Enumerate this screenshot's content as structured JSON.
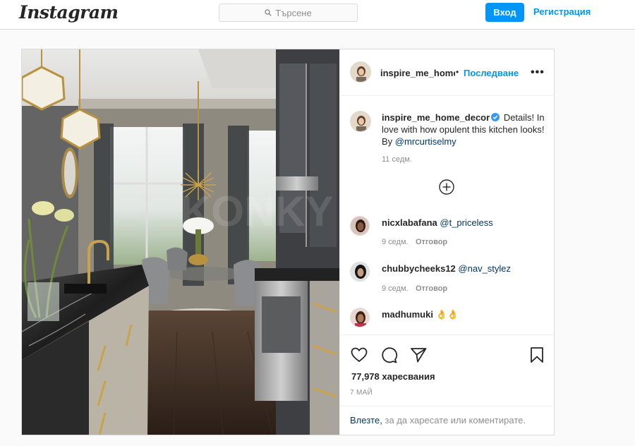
{
  "nav": {
    "logo": "Instagram",
    "search_placeholder": "Търсене",
    "login_label": "Вход",
    "register_label": "Регистрация"
  },
  "post": {
    "author": "inspire_me_home_decor",
    "author_header": "inspire_me_home",
    "dot": "•",
    "follow_label": "Последване",
    "more_label": "•••",
    "caption_text": "Details! In love with how opulent this kitchen looks! By",
    "caption_mention": "@mrcurtiselmy",
    "caption_time": "11 седм.",
    "likes": "77,978 харесвания",
    "date": "7 МАЙ",
    "login_link": "Влезте,",
    "login_rest": " за да харесате или коментирате."
  },
  "comments": [
    {
      "user": "nicxlabafana",
      "mention": "@t_priceless",
      "text": "",
      "time": "9 седм.",
      "reply": "Отговор"
    },
    {
      "user": "chubbycheeks12",
      "mention": "@nav_stylez",
      "text": "",
      "time": "9 седм.",
      "reply": "Отговор"
    },
    {
      "user": "madhumuki",
      "mention": "",
      "text": "👌👌",
      "time": "",
      "reply": ""
    }
  ],
  "icons": {
    "search": "search-icon",
    "verified": "verified-badge-icon",
    "load_more": "plus-circle-icon",
    "like": "heart-icon",
    "comment": "comment-icon",
    "share": "share-icon",
    "save": "bookmark-icon"
  },
  "colors": {
    "accent": "#0095f6",
    "mention": "#00376b",
    "muted": "#8e8e8e",
    "border": "#dbdbdb"
  }
}
